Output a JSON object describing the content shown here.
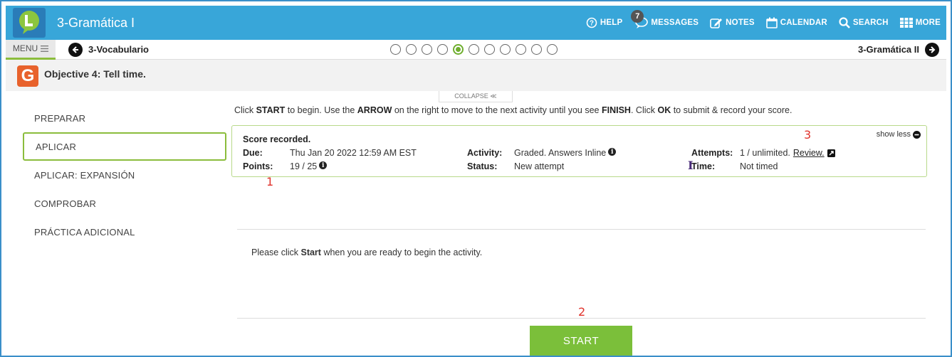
{
  "app": {
    "title": "3-Gramática I"
  },
  "topnav": {
    "help": "HELP",
    "messages": "MESSAGES",
    "messages_count": "7",
    "notes": "NOTES",
    "calendar": "CALENDAR",
    "search": "SEARCH",
    "more": "MORE"
  },
  "navbar": {
    "menu": "MENU",
    "prev": "3-Vocabulario",
    "next": "3-Gramática II",
    "progress": {
      "total_steps": 11,
      "current_step": 5
    }
  },
  "objective": {
    "title": "Objective 4: Tell time.",
    "badge_letter": "G"
  },
  "collapse": {
    "label": "COLLAPSE ≪"
  },
  "sidebar": {
    "items": [
      {
        "label": "PREPARAR",
        "active": false
      },
      {
        "label": "APLICAR",
        "active": true
      },
      {
        "label": "APLICAR: EXPANSIÓN",
        "active": false
      },
      {
        "label": "COMPROBAR",
        "active": false
      },
      {
        "label": "PRÁCTICA ADICIONAL",
        "active": false
      }
    ]
  },
  "instructions": {
    "p1": "Click ",
    "k1": "START",
    "p2": " to begin. Use the ",
    "k2": "ARROW",
    "p3": " on the right to move to the next activity until you see ",
    "k3": "FINISH",
    "p4": ". Click ",
    "k4": "OK",
    "p5": " to submit & record your score."
  },
  "score": {
    "title": "Score recorded.",
    "show_less": "show less",
    "due_label": "Due:",
    "due_value": "Thu Jan 20 2022 12:59 AM EST",
    "points_label": "Points:",
    "points_value": "19 / 25",
    "activity_label": "Activity:",
    "activity_value": "Graded. Answers Inline",
    "status_label": "Status:",
    "status_value": "New attempt",
    "attempts_label": "Attempts:",
    "attempts_value": "1 / unlimited.",
    "review_label": "Review.",
    "time_label": "Time:",
    "time_value": "Not timed"
  },
  "annotations": {
    "a1": "1",
    "a2": "2",
    "a3": "3"
  },
  "activity": {
    "prompt_pre": "Please click ",
    "prompt_bold": "Start",
    "prompt_post": " when you are ready to begin the activity.",
    "start_button": "START"
  },
  "colors": {
    "topbar": "#38a6d9",
    "accent_green": "#7bbf3a",
    "annotation_red": "#e0322b"
  }
}
